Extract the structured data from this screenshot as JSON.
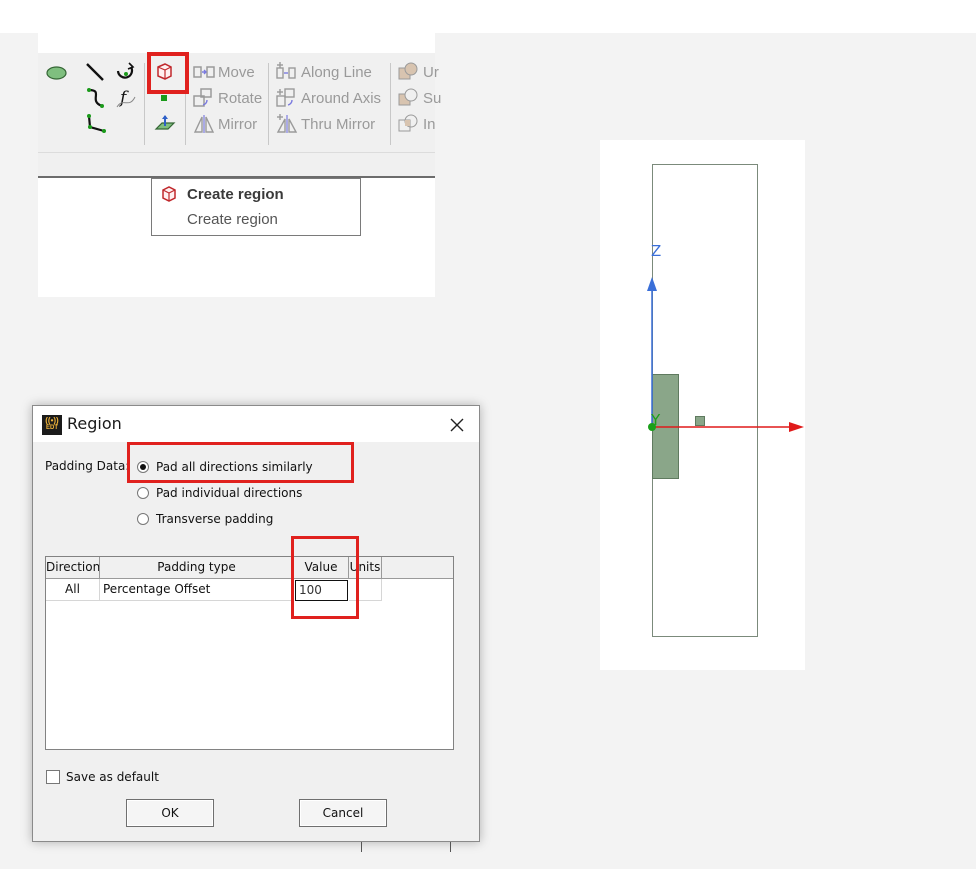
{
  "ribbon": {
    "items": [
      {
        "label": "Move",
        "icon": "move-icon"
      },
      {
        "label": "Rotate",
        "icon": "rotate-icon"
      },
      {
        "label": "Mirror",
        "icon": "mirror-icon"
      },
      {
        "label": "Along Line",
        "icon": "along-line-icon"
      },
      {
        "label": "Around Axis",
        "icon": "around-axis-icon"
      },
      {
        "label": "Thru Mirror",
        "icon": "thru-mirror-icon"
      },
      {
        "label": "Ur",
        "icon": "unite-icon"
      },
      {
        "label": "Su",
        "icon": "subtract-icon"
      },
      {
        "label": "In",
        "icon": "intersect-icon"
      }
    ],
    "highlight_color": "#e0211e"
  },
  "menu": {
    "header": "Create region",
    "item": "Create region"
  },
  "viewport": {
    "z_label": "Z",
    "y_label": "Y",
    "axis_colors": {
      "x": "#e01a1a",
      "z": "#3a6fd8",
      "y": "#1aa01a"
    },
    "solid_color": "#8aa689"
  },
  "dialog": {
    "title": "Region",
    "logo_text": "EDT",
    "padding_label": "Padding Data:",
    "options": [
      {
        "label": "Pad all directions similarly",
        "selected": true
      },
      {
        "label": "Pad individual directions",
        "selected": false
      },
      {
        "label": "Transverse padding",
        "selected": false
      }
    ],
    "table": {
      "headers": [
        "Direction",
        "Padding type",
        "Value",
        "Units"
      ],
      "rows": [
        {
          "direction": "All",
          "padding_type": "Percentage Offset",
          "value": "100",
          "units": ""
        }
      ]
    },
    "save_default_label": "Save as default",
    "save_default_checked": false,
    "ok_label": "OK",
    "cancel_label": "Cancel"
  }
}
